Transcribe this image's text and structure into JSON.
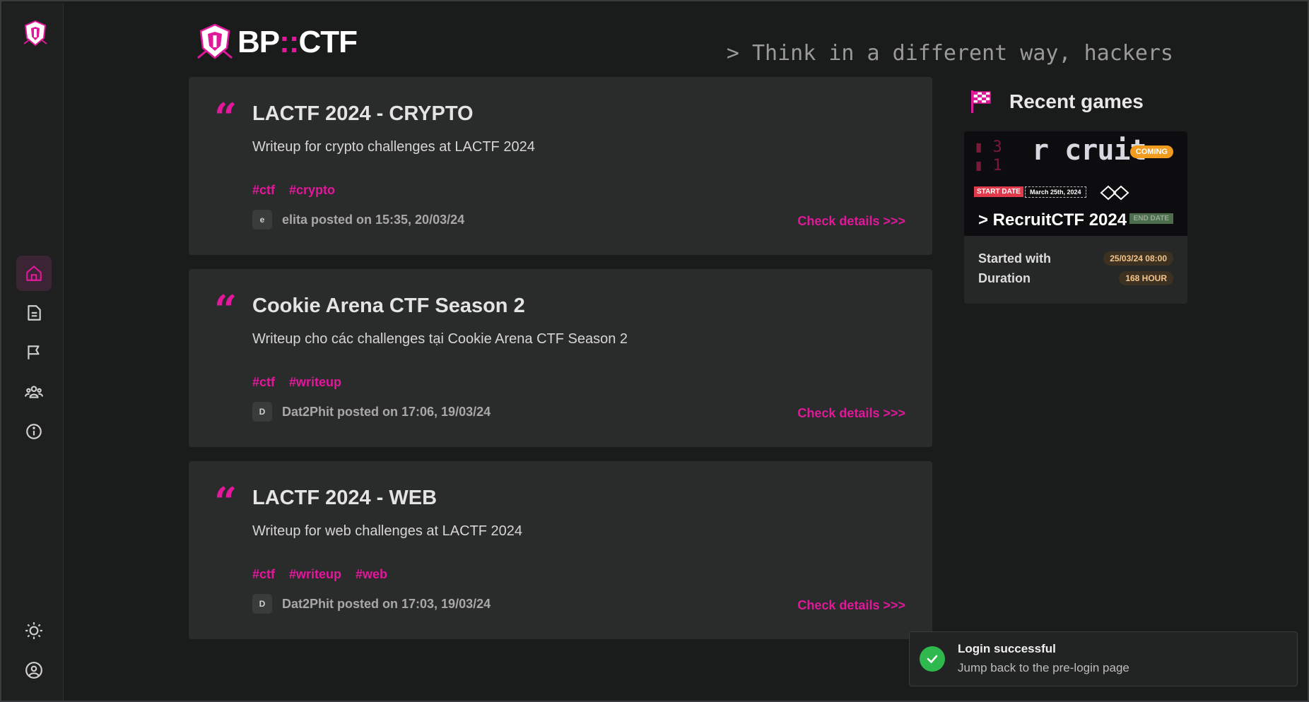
{
  "brand": {
    "name_left": "BP",
    "name_sep": "::",
    "name_right": "CTF",
    "tagline": "> Think in a different way, hackers",
    "accent": "#e0189a"
  },
  "sidebar": {
    "items": [
      {
        "name": "home-icon",
        "active": true
      },
      {
        "name": "document-icon",
        "active": false
      },
      {
        "name": "flag-icon",
        "active": false
      },
      {
        "name": "team-icon",
        "active": false
      },
      {
        "name": "info-icon",
        "active": false
      }
    ],
    "bottom": [
      {
        "name": "theme-toggle-icon"
      },
      {
        "name": "profile-icon"
      }
    ]
  },
  "posts": [
    {
      "title": "LACTF 2024 - CRYPTO",
      "description": "Writeup for crypto challenges at LACTF 2024",
      "tags": [
        "#ctf",
        "#crypto"
      ],
      "avatar": "e",
      "meta": "elita posted on 15:35, 20/03/24",
      "link": "Check details >>>"
    },
    {
      "title": "Cookie Arena CTF Season 2",
      "description": "Writeup cho các challenges tại Cookie Arena CTF Season 2",
      "tags": [
        "#ctf",
        "#writeup"
      ],
      "avatar": "D",
      "meta": "Dat2Phit posted on 17:06, 19/03/24",
      "link": "Check details >>>"
    },
    {
      "title": "LACTF 2024 - WEB",
      "description": "Writeup for web challenges at LACTF 2024",
      "tags": [
        "#ctf",
        "#writeup",
        "#web"
      ],
      "avatar": "D",
      "meta": "Dat2Phit posted on 17:03, 19/03/24",
      "link": "Check details >>>"
    }
  ],
  "recent": {
    "title": "Recent games",
    "game": {
      "banner_word": "r cruit",
      "banner_coming": "COMING",
      "banner_start_label": "START DATE",
      "banner_start_value": "March 25th, 2024",
      "banner_end_label": "END DATE",
      "banner_title": "> RecruitCTF 2024",
      "started_label": "Started with",
      "started_value": "25/03/24 08:00",
      "duration_label": "Duration",
      "duration_value": "168 HOUR"
    }
  },
  "toast": {
    "title": "Login successful",
    "message": "Jump back to the pre-login page",
    "color": "#2fb84e"
  }
}
